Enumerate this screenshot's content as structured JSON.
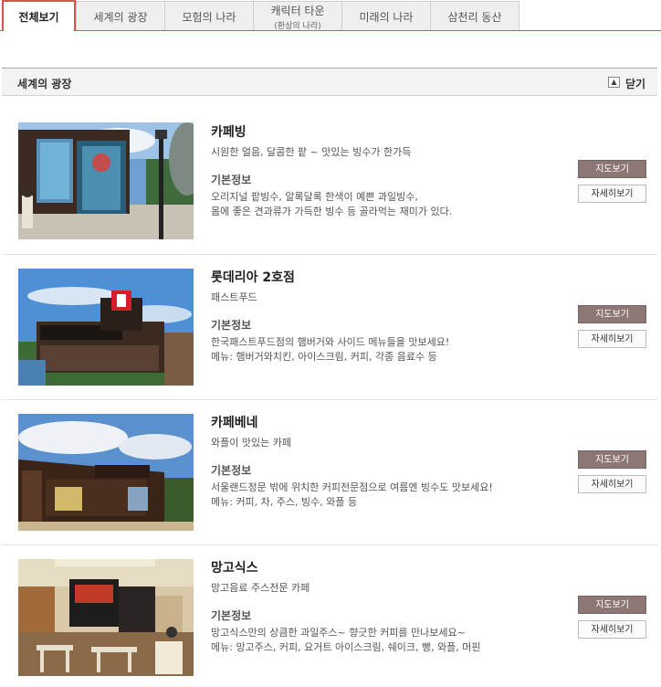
{
  "tabs": [
    {
      "label": "전체보기",
      "sub": ""
    },
    {
      "label": "세계의 광장",
      "sub": ""
    },
    {
      "label": "모험의 나라",
      "sub": ""
    },
    {
      "label": "캐릭터 타운",
      "sub": "(환상의 나라)"
    },
    {
      "label": "미래의 나라",
      "sub": ""
    },
    {
      "label": "삼천리 동산",
      "sub": ""
    }
  ],
  "section": {
    "title": "세계의 광장",
    "close_icon": "▲",
    "close_label": "닫기"
  },
  "info_heading": "기본정보",
  "buttons": {
    "map": "지도보기",
    "detail": "자세히보기"
  },
  "items": [
    {
      "name": "카페빙",
      "desc": "시원한 얼음, 달콤한 팥 ~ 맛있는 빙수가 한가득",
      "info1": "오리지널 팥빙수, 알록달록 한색이 예쁜 과일빙수,",
      "info2": "몸에 좋은 견과류가 가득한 빙수 등 골라먹는 재미가 있다."
    },
    {
      "name": "롯데리아 2호점",
      "desc": "패스트푸드",
      "info1": "한국패스트푸드점의 햄버거와 사이드 메뉴들을 맛보세요!",
      "info2": "메뉴: 햄버거와치킨, 아이스크림, 커피, 각종 음료수 등"
    },
    {
      "name": "카페베네",
      "desc": "와플이 맛있는 카페",
      "info1": "서울랜드정문 밖에 위치한 커피전문점으로 여름엔 빙수도 맛보세요!",
      "info2": "메뉴: 커피, 차, 주스, 빙수, 와플 등"
    },
    {
      "name": "망고식스",
      "desc": "망고음료 주스전문 카페",
      "info1": "망고식스만의 상큼한 과일주스~ 향긋한 커피를 만나보세요~",
      "info2": "메뉴: 망고주스, 커피, 요거트 아이스크림, 쉐이크, 빵, 와플, 머핀"
    }
  ]
}
